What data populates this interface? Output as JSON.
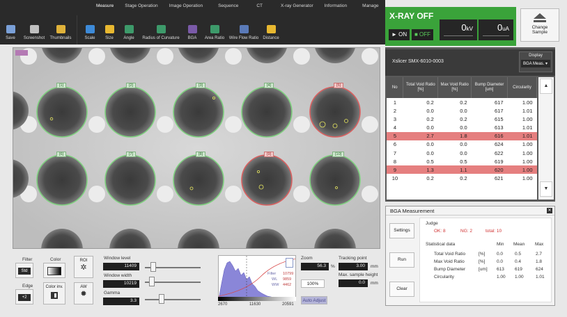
{
  "menu": [
    "Measure",
    "Stage Operation",
    "Image Operation",
    "Sequence",
    "CT",
    "X-ray Generator",
    "Information",
    "Manage"
  ],
  "tools_left": [
    "Save",
    "Screenshot",
    "Thumbnails"
  ],
  "tools_measure": [
    "Scale",
    "Size",
    "Angle",
    "Radius of Curvature",
    "BGA",
    "Area Ratio",
    "Wire Flow Ratio",
    "Distance"
  ],
  "xray": {
    "title": "X-RAY OFF",
    "on_label": "► ON",
    "off_label": "■ OFF",
    "kv_value": "0",
    "kv_unit": "kV",
    "ua_value": "0",
    "ua_unit": "uA"
  },
  "change_sample": {
    "line1": "Change",
    "line2": "Sample"
  },
  "image": {
    "tags_row1": [
      "[1]",
      "[2]",
      "[3]",
      "[4]",
      "[5]"
    ],
    "tags_row2": [
      "[6]",
      "[7]",
      "[8]",
      "[9]",
      "[10]"
    ]
  },
  "controls": {
    "filter_label": "Filter",
    "filter_value": "Std",
    "edge_label": "Edge",
    "edge_value": "+2",
    "color_label": "Color",
    "color_inv_label": "Color inv.",
    "roi_label": "ROI",
    "aw_label": "AW",
    "window_level_label": "Window level",
    "window_level_value": "11409",
    "window_width_label": "Window width",
    "window_width_value": "10219",
    "gamma_label": "Gamma",
    "gamma_value": "3.3",
    "hist_labels": [
      "Filter",
      "WL",
      "WW"
    ],
    "hist_values": [
      "10799",
      "9859",
      "4462"
    ],
    "hist_min": "2670",
    "hist_mid": "11630",
    "hist_max": "20591",
    "zoom_label": "Zoom",
    "zoom_value": "56.3",
    "zoom_unit": "%",
    "zoom_100": "100%",
    "tracking_label": "Tracking point",
    "tracking_value": "3.00",
    "tracking_unit": "mm",
    "max_height_label": "Max. sample height",
    "max_height_value": "0.0",
    "max_height_unit": "mm",
    "auto_adjust": "Auto Adjust"
  },
  "table_panel": {
    "sample_name": "Xslicer SMX-6010-0003",
    "display_label": "Display",
    "display_value": "BGA Meas. ▾",
    "headers": [
      "No",
      "Total Void Ratio [%]",
      "Max Void Ratio [%]",
      "Bump Diameter [um]",
      "Circularity"
    ],
    "rows": [
      [
        "1",
        "0.2",
        "0.2",
        "617",
        "1.00"
      ],
      [
        "2",
        "0.0",
        "0.0",
        "617",
        "1.01"
      ],
      [
        "3",
        "0.2",
        "0.2",
        "615",
        "1.00"
      ],
      [
        "4",
        "0.0",
        "0.0",
        "613",
        "1.01"
      ],
      [
        "5",
        "2.7",
        "1.8",
        "616",
        "1.01"
      ],
      [
        "6",
        "0.0",
        "0.0",
        "624",
        "1.00"
      ],
      [
        "7",
        "0.0",
        "0.0",
        "622",
        "1.00"
      ],
      [
        "8",
        "0.5",
        "0.5",
        "619",
        "1.00"
      ],
      [
        "9",
        "1.3",
        "1.1",
        "620",
        "1.00"
      ],
      [
        "10",
        "0.2",
        "0.2",
        "621",
        "1.00"
      ]
    ],
    "highlight_rows": [
      5,
      9
    ],
    "scroll_up": "▲",
    "scroll_down": "▼"
  },
  "bga": {
    "title": "BGA Measurement",
    "close": "✕",
    "settings_btn": "Settings",
    "run_btn": "Run",
    "clear_btn": "Clear",
    "judge_label": "Judge",
    "ok": "OK: 8",
    "ng": "NG: 2",
    "total": "total: 10",
    "stat_title": "Statistical data",
    "stat_cols": [
      "Min",
      "Mean",
      "Max"
    ],
    "stats": [
      {
        "name": "Total Void Ratio",
        "unit": "[%]",
        "min": "0.0",
        "mean": "0.5",
        "max": "2.7"
      },
      {
        "name": "Max Void Ratio",
        "unit": "[%]",
        "min": "0.0",
        "mean": "0.4",
        "max": "1.8"
      },
      {
        "name": "Bump Diameter",
        "unit": "[um]",
        "min": "613",
        "mean": "619",
        "max": "624"
      },
      {
        "name": "Circularity",
        "unit": "",
        "min": "1.00",
        "mean": "1.00",
        "max": "1.01"
      }
    ]
  },
  "colors": {
    "toolbar_bg": "#2a2a2a",
    "xray_green": "#3aa33a",
    "ok_ring": "#7fd07f",
    "ng_ring": "#d86060",
    "highlight_row": "#e57f7f"
  }
}
